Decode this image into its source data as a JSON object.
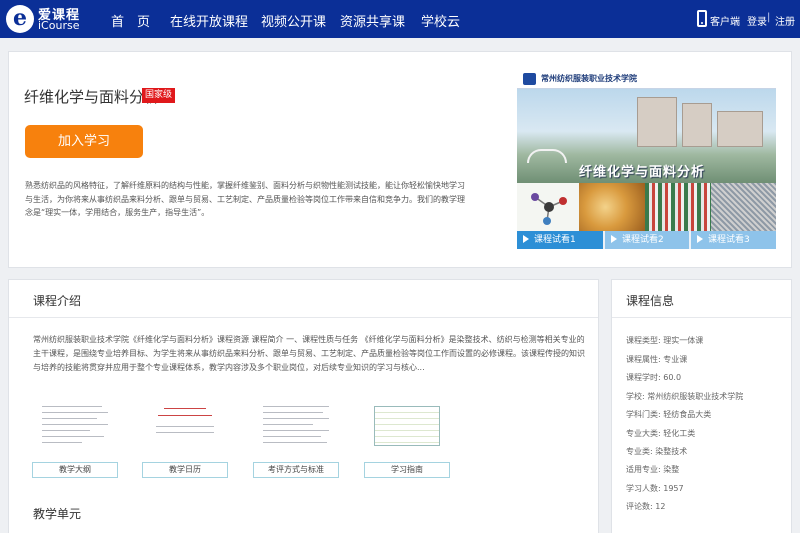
{
  "nav": {
    "logo_cn": "爱课程",
    "logo_en": "iCourse",
    "items": [
      "首　页",
      "在线开放课程",
      "视频公开课",
      "资源共享课",
      "学校云"
    ],
    "client": "客户端",
    "login": "登录",
    "divider": "|",
    "register": "注册"
  },
  "course": {
    "title": "纤维化学与面料分析",
    "badge": "国家级",
    "join_label": "加入学习",
    "description": "熟悉纺织品的风格特征，了解纤维原料的结构与性能，掌握纤维鉴别、面料分析与织物性能测试技能，能让你轻松愉快地学习与生活，为你将来从事纺织品来料分析、跟单与贸易、工艺制定、产品质量检验等岗位工作带来自信和竞争力。我们的教学理念是“理实一体，学用结合，服务生产，指导生活”。"
  },
  "banner": {
    "school_name": "常州纺织服装职业技术学院",
    "title": "纤维化学与面料分析",
    "trials": [
      "课程试看1",
      "课程试看2",
      "课程试看3"
    ]
  },
  "intro": {
    "heading": "课程介绍",
    "text": "常州纺织服装职业技术学院《纤维化学与面料分析》课程资源 课程简介 一、课程性质与任务 《纤维化学与面料分析》是染整技术、纺织与检测等相关专业的主干课程，是围绕专业培养目标、为学生将来从事纺织品来料分析、跟单与贸易、工艺制定、产品质量检验等岗位工作而设置的必修课程。该课程传授的知识与培养的技能将贯穿并应用于整个专业课程体系，教学内容涉及多个职业岗位，对后续专业知识的学习与核心...",
    "docs": [
      "教学大纲",
      "教学日历",
      "考评方式与标准",
      "学习指南"
    ]
  },
  "units": {
    "heading": "教学单元"
  },
  "info": {
    "heading": "课程信息",
    "rows": [
      "课程类型: 理实一体课",
      "课程属性: 专业课",
      "课程学时: 60.0",
      "学校: 常州纺织服装职业技术学院",
      "学科门类: 轻纺食品大类",
      "专业大类: 轻化工类",
      "专业类: 染整技术",
      "适用专业: 染整",
      "学习人数: 1957",
      "评论数: 12"
    ]
  },
  "colors": {
    "nav_bg": "#0b2f97",
    "join_button": "#f7810d",
    "badge": "#e0181b",
    "trial_active": "#2d8fd6",
    "trial_inactive": "#8ec3ea"
  }
}
